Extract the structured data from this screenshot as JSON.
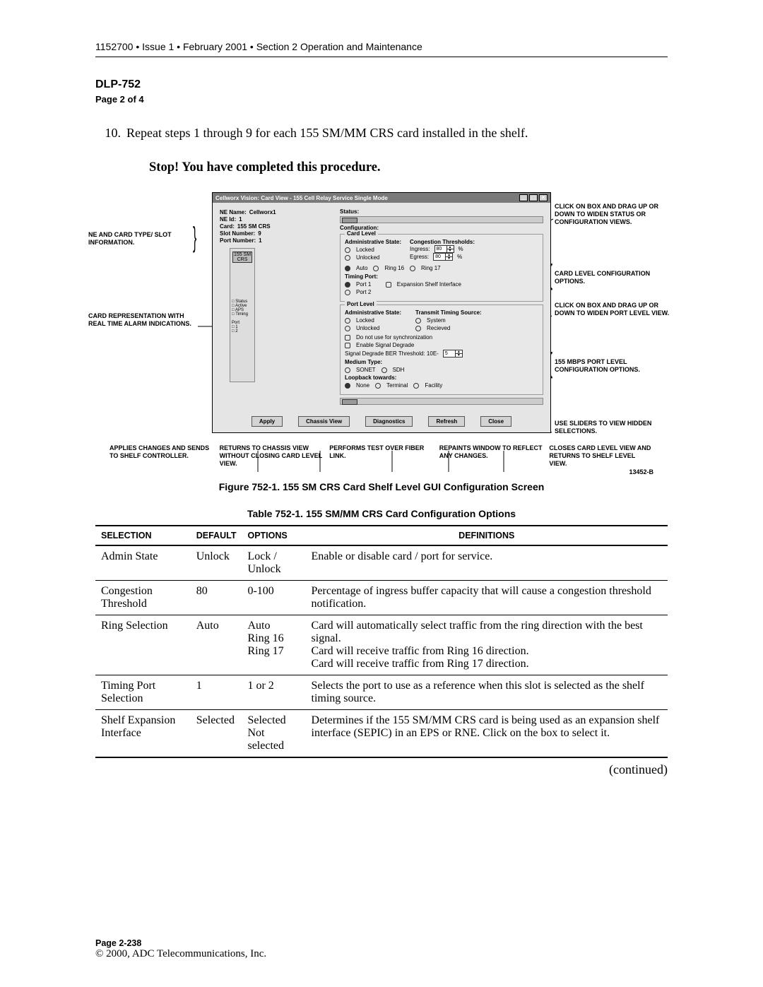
{
  "header": "1152700 • Issue 1 • February 2001 • Section 2 Operation and Maintenance",
  "dlp": "DLP-752",
  "page_of": "Page 2 of 4",
  "step": {
    "num": "10.",
    "text": "Repeat steps 1 through 9 for each 155 SM/MM CRS card installed in the shelf."
  },
  "stop": "Stop! You have completed this procedure.",
  "window": {
    "title": "Cellworx Vision:  Card View - 155 Cell Relay Service Single Mode",
    "info": {
      "ne_name_lbl": "NE Name:",
      "ne_name": "Cellworx1",
      "ne_id_lbl": "NE Id:",
      "ne_id": "1",
      "card_lbl": "Card:",
      "card": "155 SM CRS",
      "slot_lbl": "Slot Number:",
      "slot": "9",
      "port_lbl": "Port Number:",
      "port": "1"
    },
    "status_lbl": "Status:",
    "config_lbl": "Configuration:",
    "card_box_title": "155 SM\nCRS",
    "card_indicators": [
      "Status",
      "Active",
      "APS",
      "Timing"
    ],
    "port_label": "Port",
    "port_nums": [
      "1",
      "2"
    ],
    "card_level": {
      "title": "Card Level",
      "admin_lbl": "Administrative State:",
      "locked": "Locked",
      "unlocked": "Unlocked",
      "cong_lbl": "Congestion Thresholds:",
      "ingress": "Ingress:",
      "egress": "Egress:",
      "val": "80",
      "pct": "%",
      "auto": "Auto",
      "ring16": "Ring 16",
      "ring17": "Ring 17",
      "tport_lbl": "Timing Port:",
      "port1": "Port 1",
      "port2": "Port 2",
      "exp_chk": "Expansion Shelf Interface"
    },
    "port_level": {
      "title": "Port Level",
      "admin_lbl": "Administrative State:",
      "locked": "Locked",
      "unlocked": "Unlocked",
      "tts_lbl": "Transmit Timing Source:",
      "system": "System",
      "recieved": "Recieved",
      "nosync": "Do not use for synchronization",
      "ensd": "Enable Signal Degrade",
      "sdber": "Signal Degrade BER Threshold: 10E-",
      "sdval": "5",
      "medium_lbl": "Medium Type:",
      "sonet": "SONET",
      "sdh": "SDH",
      "loop_lbl": "Loopback towards:",
      "none": "None",
      "terminal": "Terminal",
      "facility": "Facility"
    },
    "buttons": [
      "Apply",
      "Chassis View",
      "Diagnostics",
      "Refresh",
      "Close"
    ]
  },
  "annotations": {
    "left1": "NE AND CARD TYPE/ SLOT INFORMATION.",
    "left2": "CARD REPRESENTATION WITH REAL TIME ALARM INDICATIONS.",
    "right1": "CLICK ON BOX AND DRAG UP OR DOWN TO WIDEN STATUS OR CONFIGURATION VIEWS.",
    "right2": "CARD LEVEL CONFIGURATION OPTIONS.",
    "right3": "CLICK ON BOX AND DRAG UP OR DOWN TO WIDEN PORT LEVEL VIEW.",
    "right4": "155 MBPS PORT LEVEL CONFIGURATION OPTIONS.",
    "right5": "USE SLIDERS TO VIEW HIDDEN SELECTIONS.",
    "bottom": [
      "APPLIES CHANGES AND SENDS TO SHELF CONTROLLER.",
      "RETURNS TO CHASSIS VIEW WITHOUT CLOSING CARD LEVEL VIEW.",
      "PERFORMS TEST OVER FIBER LINK.",
      "REPAINTS WINDOW TO REFLECT ANY CHANGES.",
      "CLOSES CARD LEVEL VIEW AND RETURNS TO SHELF LEVEL VIEW."
    ],
    "code": "13452-B"
  },
  "figure_caption": "Figure 752-1. 155 SM CRS Card Shelf Level GUI Configuration Screen",
  "table_caption": "Table 752-1. 155 SM/MM CRS Card Configuration Options",
  "table": {
    "headers": [
      "SELECTION",
      "DEFAULT",
      "OPTIONS",
      "DEFINITIONS"
    ],
    "rows": [
      {
        "sel": "Admin State",
        "def": "Unlock",
        "opt": "Lock / Unlock",
        "defn": "Enable or disable card / port for service."
      },
      {
        "sel": "Congestion Threshold",
        "def": "80",
        "opt": "0-100",
        "defn": "Percentage of ingress buffer capacity that will cause a congestion threshold notification."
      },
      {
        "sel": "Ring Selection",
        "def": "Auto",
        "opt": "Auto\nRing 16\nRing 17",
        "defn": "Card will automatically select traffic from the ring direction with the best signal.\nCard will receive traffic from Ring 16 direction.\nCard will receive traffic from Ring 17 direction."
      },
      {
        "sel": "Timing Port Selection",
        "def": "1",
        "opt": "1 or 2",
        "defn": "Selects the port to use as a reference when this slot is selected as the shelf timing source."
      },
      {
        "sel": "Shelf Expansion Interface",
        "def": "Selected",
        "opt": "Selected\nNot selected",
        "defn": "Determines if the 155 SM/MM CRS card is being used as an expansion shelf interface (SEPIC) in an EPS or RNE. Click on the box to select it."
      }
    ]
  },
  "continued": "(continued)",
  "footer": {
    "page": "Page 2-238",
    "copy": "© 2000, ADC Telecommunications, Inc."
  }
}
